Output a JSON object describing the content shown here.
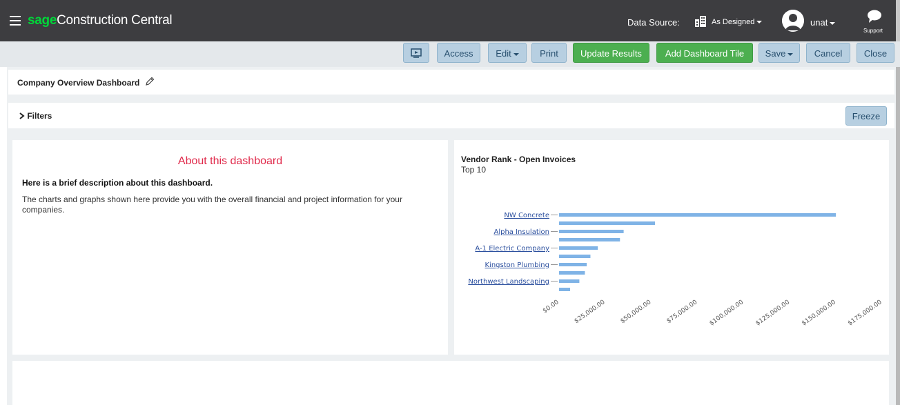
{
  "header": {
    "brand_sage": "sage",
    "brand_rest": "Construction Central",
    "data_source_label": "Data Source:",
    "data_source_value": "As Designed",
    "user_name": "unat",
    "support_label": "Support"
  },
  "toolbar": {
    "access_label": "Access",
    "edit_label": "Edit",
    "print_label": "Print",
    "update_results_label": "Update Results",
    "add_tile_label": "Add Dashboard Tile",
    "save_label": "Save",
    "cancel_label": "Cancel",
    "close_label": "Close"
  },
  "dashboard": {
    "title": "Company Overview Dashboard",
    "filters_label": "Filters",
    "freeze_label": "Freeze"
  },
  "about_tile": {
    "heading": "About this dashboard",
    "subheading": "Here is a brief description about this dashboard.",
    "body": "The charts and graphs shown here provide you with the overall financial and project information for your companies."
  },
  "vendor_tile": {
    "title": "Vendor Rank - Open Invoices",
    "subtitle": "Top 10"
  },
  "colors": {
    "bar": "#7fb3e6",
    "green_button": "#4caf50",
    "blue_button": "#b7cfe1",
    "accent_heading": "#e0294a"
  },
  "chart_data": {
    "type": "bar",
    "orientation": "horizontal",
    "title": "Vendor Rank - Open Invoices",
    "subtitle": "Top 10",
    "categories": [
      "NW Concrete",
      "",
      "Alpha Insulation",
      "",
      "A-1 Electric Company",
      "",
      "Kingston Plumbing",
      "",
      "Northwest Landscaping",
      ""
    ],
    "values": [
      150000,
      52000,
      35000,
      33000,
      21000,
      17000,
      15000,
      14000,
      11000,
      6000
    ],
    "x_ticks": [
      "$0.00",
      "$25,000.00",
      "$50,000.00",
      "$75,000.00",
      "$100,000.00",
      "$125,000.00",
      "$150,000.00",
      "$175,000.00"
    ],
    "xlim": [
      0,
      175000
    ],
    "grid": false
  }
}
